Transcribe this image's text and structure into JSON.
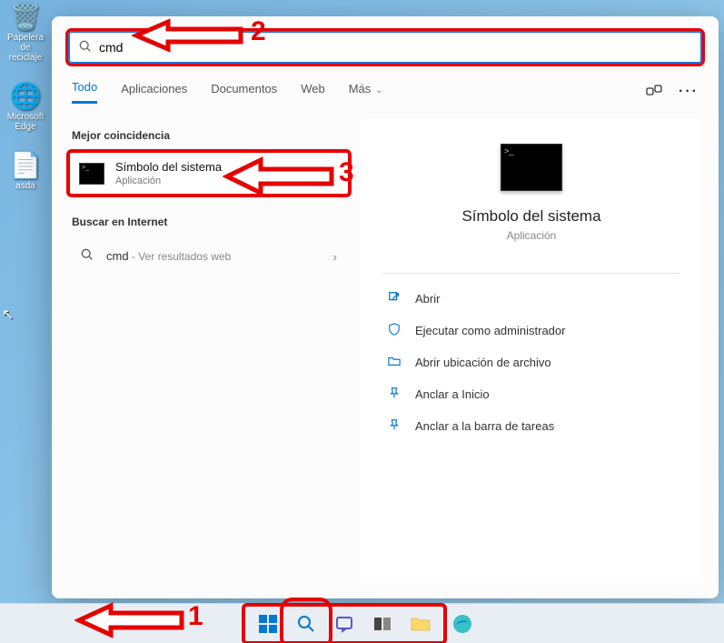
{
  "desktop": {
    "icons": [
      {
        "label": "Papelera de reciclaje"
      },
      {
        "label": "Microsoft Edge"
      },
      {
        "label": "asda"
      }
    ]
  },
  "search": {
    "value": "cmd",
    "tabs": {
      "all": "Todo",
      "apps": "Aplicaciones",
      "docs": "Documentos",
      "web": "Web",
      "more": "Más"
    },
    "best_match_label": "Mejor coincidencia",
    "best_match": {
      "title": "Símbolo del sistema",
      "subtitle": "Aplicación"
    },
    "internet_label": "Buscar en Internet",
    "web_result": {
      "term": "cmd",
      "suffix": " - Ver resultados web"
    }
  },
  "detail": {
    "title": "Símbolo del sistema",
    "subtitle": "Aplicación",
    "actions": {
      "open": "Abrir",
      "admin": "Ejecutar como administrador",
      "location": "Abrir ubicación de archivo",
      "pin_start": "Anclar a Inicio",
      "pin_taskbar": "Anclar a la barra de tareas"
    }
  },
  "annotations": {
    "step1": "1",
    "step2": "2",
    "step3": "3"
  }
}
